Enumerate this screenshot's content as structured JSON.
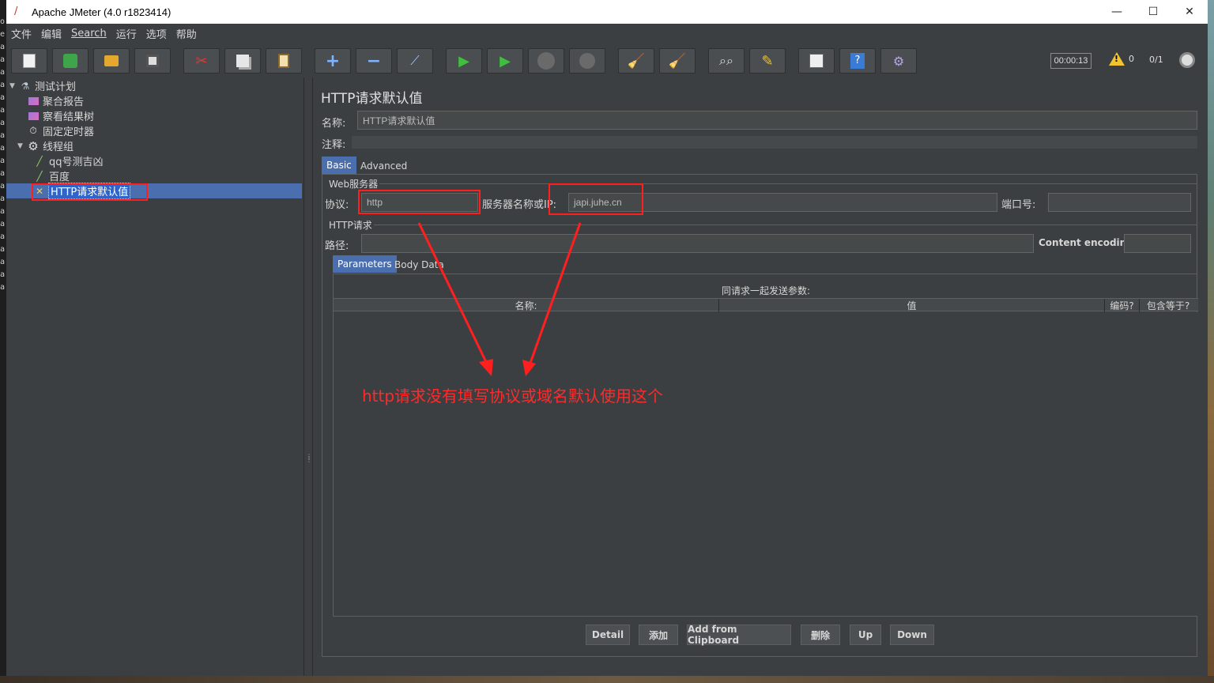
{
  "window": {
    "title": "Apache JMeter (4.0 r1823414)",
    "controls": {
      "minimize": "—",
      "maximize": "☐",
      "close": "✕"
    }
  },
  "menu": [
    "文件",
    "编辑",
    "Search",
    "运行",
    "选项",
    "帮助"
  ],
  "toolbar": {
    "buttons": [
      "new-icon",
      "templates-icon",
      "open-icon",
      "save-icon",
      "cut-icon",
      "copy-icon",
      "paste-icon",
      "expand-icon",
      "collapse-icon",
      "toggle-icon",
      "start-icon",
      "start-no-pause-icon",
      "stop-icon",
      "shutdown-icon",
      "clear-icon",
      "clear-all-icon",
      "search-icon",
      "reset-search-icon",
      "function-helper-icon",
      "help-icon",
      "remote-icon"
    ],
    "timer": "00:00:13",
    "warning_count": "0",
    "threads": "0/1"
  },
  "tree": {
    "items": [
      {
        "label": "测试计划",
        "icon": "test-plan-icon"
      },
      {
        "label": "聚合报告",
        "icon": "report-icon"
      },
      {
        "label": "察看结果树",
        "icon": "report-icon"
      },
      {
        "label": "固定定时器",
        "icon": "timer-icon"
      },
      {
        "label": "线程组",
        "icon": "gear-icon"
      },
      {
        "label": "qq号测吉凶",
        "icon": "sampler-icon"
      },
      {
        "label": "百度",
        "icon": "sampler-icon"
      },
      {
        "label": "HTTP请求默认值",
        "icon": "config-icon"
      }
    ]
  },
  "panel": {
    "title": "HTTP请求默认值",
    "name_label": "名称:",
    "name_value": "HTTP请求默认值",
    "comment_label": "注释:",
    "tabs": [
      "Basic",
      "Advanced"
    ],
    "web_server": {
      "title": "Web服务器",
      "protocol_label": "协议:",
      "protocol_value": "http",
      "server_label": "服务器名称或IP:",
      "server_value": "japi.juhe.cn",
      "port_label": "端口号:",
      "port_value": ""
    },
    "http_request": {
      "title": "HTTP请求",
      "path_label": "路径:",
      "path_value": "",
      "encoding_label": "Content encoding:",
      "encoding_value": ""
    },
    "sub_tabs": [
      "Parameters",
      "Body Data"
    ],
    "params_caption": "同请求一起发送参数:",
    "columns": [
      "名称:",
      "值",
      "编码?",
      "包含等于?"
    ],
    "buttons": [
      "Detail",
      "添加",
      "Add from Clipboard",
      "删除",
      "Up",
      "Down"
    ]
  },
  "annotation": {
    "text": "http请求没有填写协议或域名默认使用这个",
    "color": "#ff2a2a"
  },
  "desktop_left_chars": [
    "o",
    "e",
    "a",
    "a",
    "a",
    "a",
    "a",
    "a",
    "a",
    "a",
    "a",
    "a",
    "a",
    "a",
    "a",
    "a",
    "a",
    "a",
    "a",
    "a",
    "a",
    "a"
  ]
}
